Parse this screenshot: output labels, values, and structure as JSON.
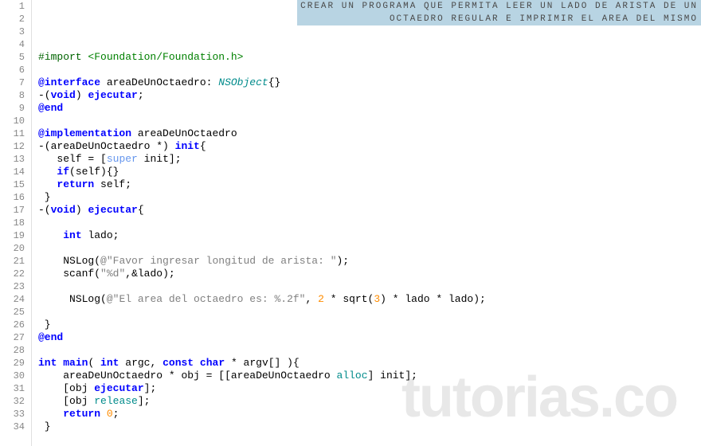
{
  "comment": {
    "line1": "CREAR UN PROGRAMA QUE PERMITA LEER UN LADO DE ARISTA DE UN",
    "line2": "OCTAEDRO REGULAR E IMPRIMIR EL AREA DEL MISMO"
  },
  "watermark": "tutorias.co",
  "lines": {
    "l1": "1",
    "l2": "2",
    "l3": "3",
    "l4": "4",
    "l5": "5",
    "l6": "6",
    "l7": "7",
    "l8": "8",
    "l9": "9",
    "l10": "10",
    "l11": "11",
    "l12": "12",
    "l13": "13",
    "l14": "14",
    "l15": "15",
    "l16": "16",
    "l17": "17",
    "l18": "18",
    "l19": "19",
    "l20": "20",
    "l21": "21",
    "l22": "22",
    "l23": "23",
    "l24": "24",
    "l25": "25",
    "l26": "26",
    "l27": "27",
    "l28": "28",
    "l29": "29",
    "l30": "30",
    "l31": "31",
    "l32": "32",
    "l33": "33",
    "l34": "34"
  },
  "code": {
    "import": "#import",
    "foundation": "<Foundation/Foundation.h>",
    "interface": "@interface",
    "className": "areaDeUnOctaedro",
    "nsobject": "NSObject",
    "void": "void",
    "ejecutar": "ejecutar",
    "end": "@end",
    "implementation": "@implementation",
    "init": "init",
    "self": "self",
    "super": "super",
    "if": "if",
    "return": "return",
    "int": "int",
    "lado": "lado",
    "nslog": "NSLog",
    "str1": "@\"Favor ingresar longitud de arista: \"",
    "scanf": "scanf",
    "str2": "\"%d\"",
    "amplado": ",&lado);",
    "str3": "@\"El area del octaedro es: %.2f\"",
    "two": "2",
    "sqrt": "sqrt",
    "three": "3",
    "main": "main",
    "argc": "argc",
    "const": "const",
    "char": "char",
    "argv": "argv[] ",
    "obj": "obj",
    "alloc": "alloc",
    "release": "release",
    "zero": "0"
  }
}
